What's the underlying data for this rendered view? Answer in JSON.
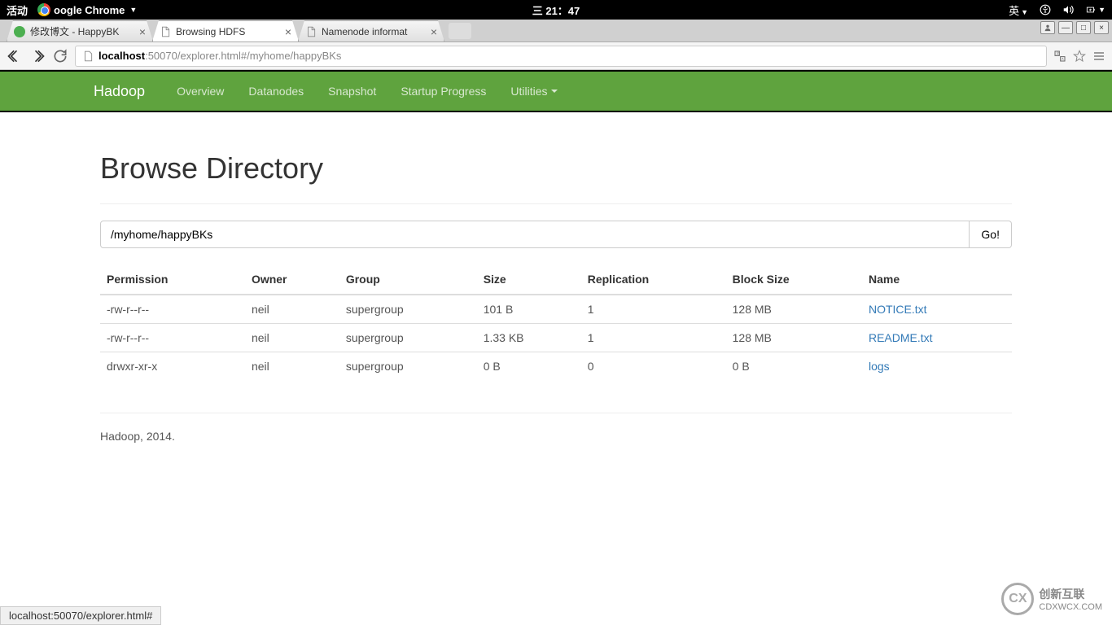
{
  "system": {
    "activity": "活动",
    "chrome_label": "oogle Chrome",
    "time": "三 21：47",
    "lang": "英"
  },
  "browser": {
    "tabs": [
      {
        "title": "修改博文 - HappyBK",
        "active": false
      },
      {
        "title": "Browsing HDFS",
        "active": true
      },
      {
        "title": "Namenode informat",
        "active": false
      }
    ],
    "url_host": "localhost",
    "url_path": ":50070/explorer.html#/myhome/happyBKs",
    "translate_icon": true
  },
  "navbar": {
    "brand": "Hadoop",
    "items": [
      "Overview",
      "Datanodes",
      "Snapshot",
      "Startup Progress",
      "Utilities"
    ]
  },
  "page": {
    "title": "Browse Directory",
    "path_input": "/myhome/happyBKs",
    "go_label": "Go!",
    "table_headers": [
      "Permission",
      "Owner",
      "Group",
      "Size",
      "Replication",
      "Block Size",
      "Name"
    ],
    "rows": [
      {
        "perm": "-rw-r--r--",
        "owner": "neil",
        "group": "supergroup",
        "size": "101 B",
        "repl": "1",
        "block": "128 MB",
        "name": "NOTICE.txt"
      },
      {
        "perm": "-rw-r--r--",
        "owner": "neil",
        "group": "supergroup",
        "size": "1.33 KB",
        "repl": "1",
        "block": "128 MB",
        "name": "README.txt"
      },
      {
        "perm": "drwxr-xr-x",
        "owner": "neil",
        "group": "supergroup",
        "size": "0 B",
        "repl": "0",
        "block": "0 B",
        "name": "logs"
      }
    ],
    "footer": "Hadoop, 2014."
  },
  "status_bar": "localhost:50070/explorer.html#",
  "watermark": {
    "logo": "CX",
    "bold": "创新互联",
    "sub": "CDXWCX.COM"
  }
}
